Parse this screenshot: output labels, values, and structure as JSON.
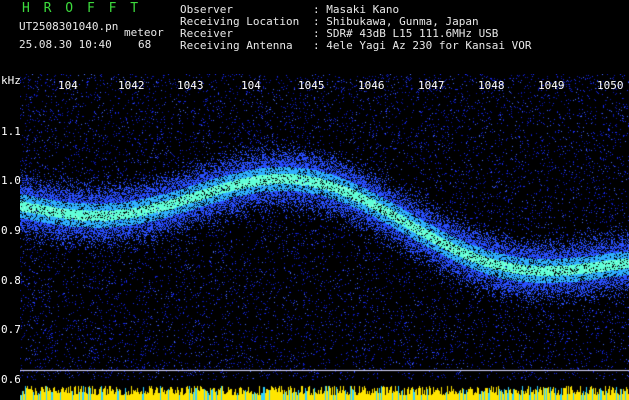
{
  "app": {
    "logo": "H R O F F T"
  },
  "info_left": {
    "filename": "UT2508301040.pn",
    "tag": "meteor",
    "datetime": "25.08.30 10:40",
    "count": "68"
  },
  "info_right": {
    "observer_label": "Observer",
    "observer_value": ": Masaki Kano",
    "location_label": "Receiving Location",
    "location_value": ": Shibukawa, Gunma, Japan",
    "receiver_label": "Receiver",
    "receiver_value": ": SDR# 43dB L15 111.6MHz USB",
    "antenna_label": "Receiving Antenna",
    "antenna_value": ": 4ele Yagi Az 230 for Kansai VOR"
  },
  "y_axis": {
    "unit": "kHz",
    "ticks": [
      "1.1",
      "1.0",
      "0.9",
      "0.8",
      "0.7",
      "0.6"
    ]
  },
  "x_axis": {
    "ticks": [
      "104",
      "1042",
      "1043",
      "104",
      "1045",
      "1046",
      "1047",
      "1048",
      "1049",
      "1050"
    ]
  },
  "colors": {
    "background": "#000000",
    "noise": "#1a2cff",
    "signal": "#40ffd0",
    "bottom_bar": "#ffe600",
    "logo": "#3ddc3d"
  }
}
